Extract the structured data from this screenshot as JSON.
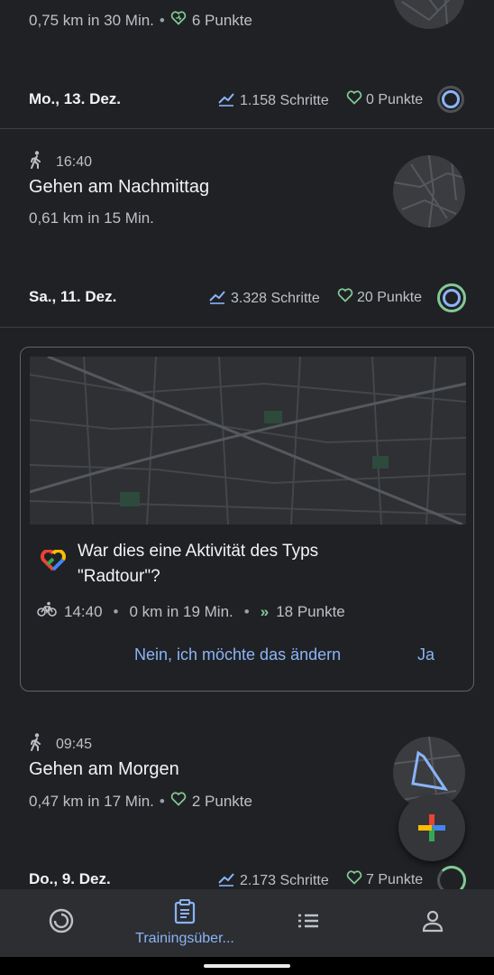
{
  "top_partial": {
    "summary": "0,75 km in 30 Min.",
    "points": "6 Punkte"
  },
  "day_mo": {
    "date": "Mo., 13. Dez.",
    "steps": "1.158 Schritte",
    "points": "0 Punkte"
  },
  "activity_1": {
    "time": "16:40",
    "title": "Gehen am Nachmittag",
    "summary": "0,61 km in 15 Min."
  },
  "day_sa": {
    "date": "Sa., 11. Dez.",
    "steps": "3.328 Schritte",
    "points": "20 Punkte"
  },
  "prompt_card": {
    "question_line1": "War dies eine Aktivität des Typs",
    "question_line2": "\"Radtour\"?",
    "time": "14:40",
    "summary": "0 km in 19 Min.",
    "points": "18 Punkte",
    "no_label": "Nein, ich möchte das ändern",
    "yes_label": "Ja"
  },
  "activity_2": {
    "time": "09:45",
    "title": "Gehen am Morgen",
    "summary": "0,47 km in 17 Min.",
    "points": "2 Punkte"
  },
  "day_do": {
    "date": "Do., 9. Dez.",
    "steps": "2.173 Schritte",
    "points": "7 Punkte"
  },
  "nav": {
    "journal_label": "Trainingsüber..."
  },
  "colors": {
    "accent_blue": "#8ab4f8",
    "heart_green": "#81c995",
    "background": "#202124",
    "navbar": "#2d2e31"
  },
  "icons": [
    "walk-icon",
    "steps-icon",
    "heart-points-icon",
    "bike-icon",
    "google-fit-logo",
    "add-icon",
    "home-icon",
    "journal-icon",
    "browse-icon",
    "profile-icon"
  ]
}
